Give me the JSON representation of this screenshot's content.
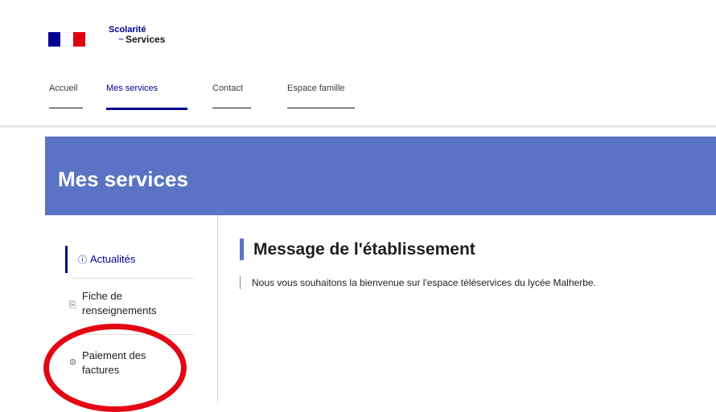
{
  "brand": {
    "line1": "Scolarité",
    "line2": "Services",
    "swirl": "~"
  },
  "nav": {
    "items": [
      "Accueil",
      "Mes services",
      "Contact",
      "Espace famille"
    ]
  },
  "banner": {
    "title": "Mes services"
  },
  "sidebar": {
    "items": [
      {
        "icon": "info-icon",
        "glyph": "ⓘ",
        "label": "Actualités"
      },
      {
        "icon": "document-icon",
        "glyph": "⎘",
        "label": "Fiche de renseignements"
      },
      {
        "icon": "payment-icon",
        "glyph": "⊜",
        "label": "Paiement des factures"
      }
    ]
  },
  "main": {
    "title": "Message de l'établissement",
    "message": "Nous vous souhaitons la bienvenue sur l'espace téléservices du lycée Malherbe."
  },
  "colors": {
    "accent": "#000091",
    "banner": "#5a73c4",
    "annotation": "#e30613"
  }
}
